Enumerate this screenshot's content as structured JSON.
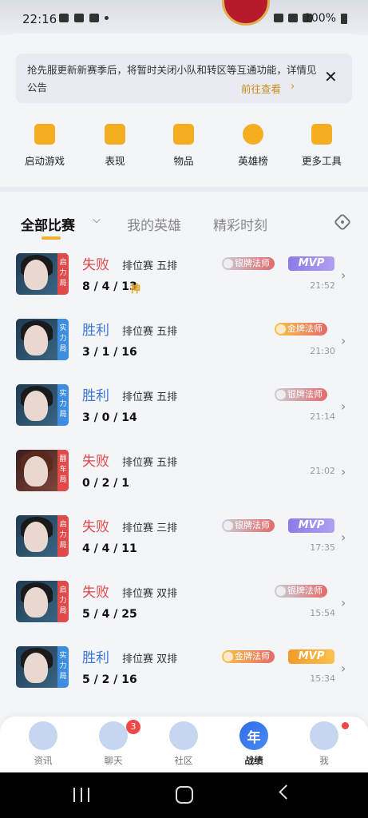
{
  "status_bar": {
    "time": "22:16",
    "battery": "100%"
  },
  "notice": {
    "text": "抢先服更新新赛季后，将暂时关闭小队和转区等互通功能，详情见公告",
    "link_label": "前往查看",
    "chevron": "›",
    "close": "✕"
  },
  "quick_actions": [
    {
      "label": "启动游戏",
      "icon": "gamepad-icon"
    },
    {
      "label": "表现",
      "icon": "chart-icon"
    },
    {
      "label": "物品",
      "icon": "bag-icon"
    },
    {
      "label": "英雄榜",
      "icon": "medal-icon"
    },
    {
      "label": "更多工具",
      "icon": "grid-icon"
    }
  ],
  "tabs": [
    {
      "label": "全部比赛",
      "active": true
    },
    {
      "label": "我的英雄",
      "active": false
    },
    {
      "label": "精彩时刻",
      "active": false
    }
  ],
  "tab_caret": "⌵",
  "matches": [
    {
      "tag": "启力局",
      "result": "失败",
      "mode": "排位赛 五排",
      "kda": "8 / 4 / 13",
      "god": "神",
      "badge": "银牌法师",
      "mvp": "MVP",
      "time": "21:52"
    },
    {
      "tag": "实力局",
      "result": "胜利",
      "mode": "排位赛 五排",
      "kda": "3 / 1 / 16",
      "badge": "金牌法师",
      "time": "21:30"
    },
    {
      "tag": "实力局",
      "result": "胜利",
      "mode": "排位赛 五排",
      "kda": "3 / 0 / 14",
      "badge": "银牌法师",
      "time": "21:14"
    },
    {
      "tag": "翻车局",
      "result": "失败",
      "mode": "排位赛 五排",
      "kda": "0 / 2 / 1",
      "time": "21:02"
    },
    {
      "tag": "启力局",
      "result": "失败",
      "mode": "排位赛 三排",
      "kda": "4 / 4 / 11",
      "badge": "银牌法师",
      "mvp": "MVP",
      "time": "17:35"
    },
    {
      "tag": "启力局",
      "result": "失败",
      "mode": "排位赛 双排",
      "kda": "5 / 4 / 25",
      "badge": "银牌法师",
      "time": "15:54"
    },
    {
      "tag": "实力局",
      "result": "胜利",
      "mode": "排位赛 双排",
      "kda": "5 / 2 / 16",
      "badge": "金牌法师",
      "mvp": "MVP",
      "time": "15:34"
    }
  ],
  "bottom_nav": [
    {
      "label": "资讯"
    },
    {
      "label": "聊天",
      "badge": "3"
    },
    {
      "label": "社区"
    },
    {
      "label": "战绩",
      "active": true,
      "icon_text": "年"
    },
    {
      "label": "我"
    }
  ],
  "colors": {
    "accent": "#f0b030",
    "lose": "#e04848",
    "win": "#3a78d6",
    "gold": "#e2a11c"
  }
}
